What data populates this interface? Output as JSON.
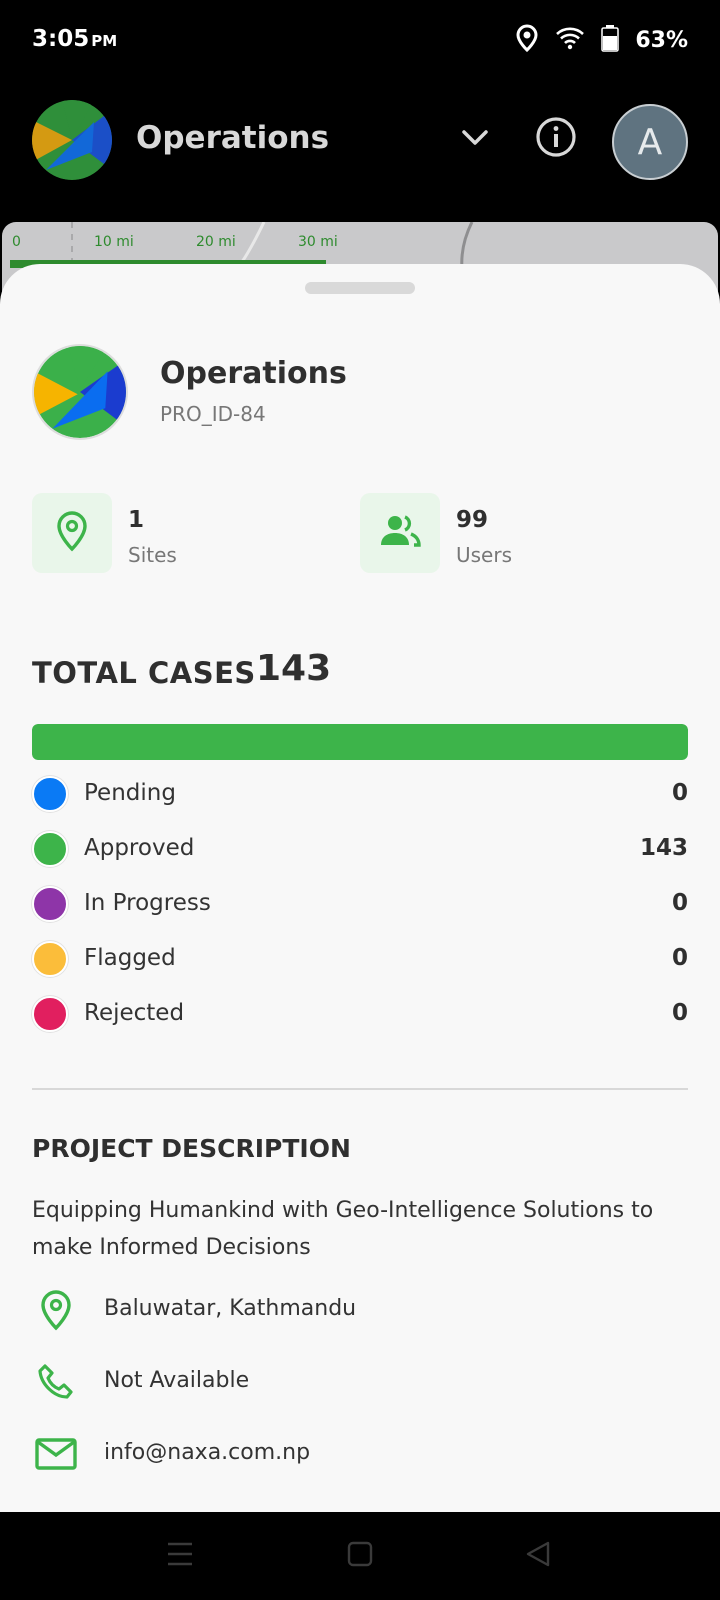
{
  "status_bar": {
    "time": "3:05",
    "ampm": "PM",
    "battery": "63%",
    "icons": [
      "location-icon",
      "wifi-icon",
      "battery-icon"
    ]
  },
  "app_bar": {
    "title": "Operations",
    "avatar_letter": "A",
    "icons": [
      "logo",
      "chevron-down-icon",
      "info-icon"
    ]
  },
  "map": {
    "scale_labels": [
      "0",
      "10 mi",
      "20 mi",
      "30 mi"
    ]
  },
  "project": {
    "name": "Operations",
    "id": "PRO_ID-84"
  },
  "stats": {
    "sites": {
      "value": "1",
      "label": "Sites"
    },
    "users": {
      "value": "99",
      "label": "Users"
    }
  },
  "cases": {
    "label": "TOTAL CASES",
    "total": "143",
    "approved_fraction": 1.0,
    "statuses": [
      {
        "name": "Pending",
        "count": "0",
        "color": "#0a7af5"
      },
      {
        "name": "Approved",
        "count": "143",
        "color": "#3db44a"
      },
      {
        "name": "In Progress",
        "count": "0",
        "color": "#8e35a8"
      },
      {
        "name": "Flagged",
        "count": "0",
        "color": "#fbbd3a"
      },
      {
        "name": "Rejected",
        "count": "0",
        "color": "#e11f5f"
      }
    ]
  },
  "description": {
    "heading": "PROJECT DESCRIPTION",
    "text": "Equipping Humankind with Geo-Intelligence Solutions to make Informed Decisions"
  },
  "contact": {
    "address": "Baluwatar, Kathmandu",
    "phone": "Not Available",
    "email": "info@naxa.com.np"
  },
  "colors": {
    "accent": "#3db44a",
    "icon_bg": "#e9f6ea"
  }
}
